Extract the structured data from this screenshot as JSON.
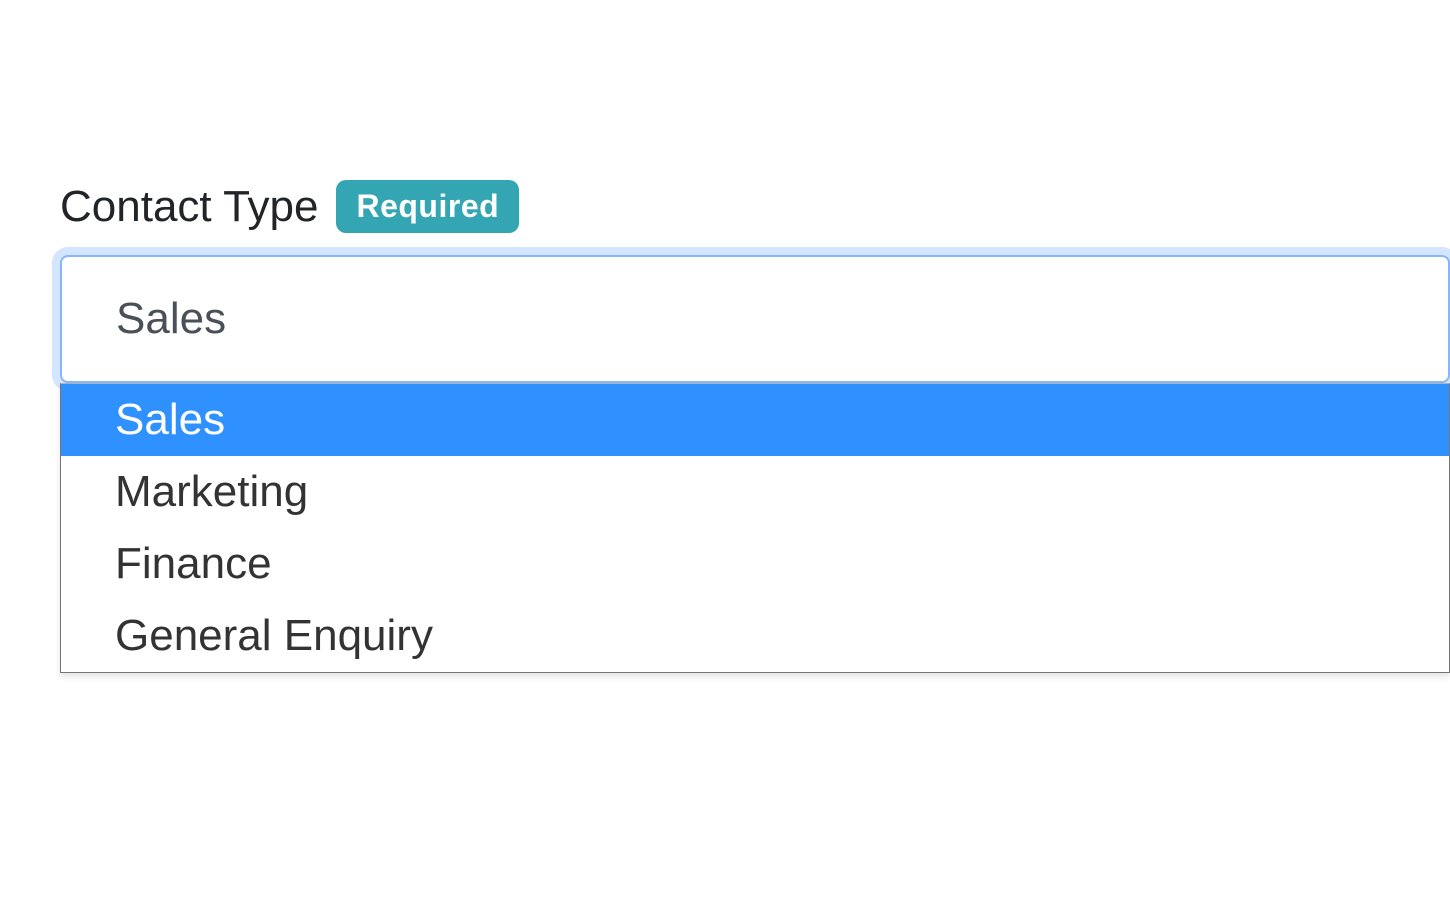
{
  "form": {
    "contactType": {
      "label": "Contact Type",
      "badge": "Required",
      "selectedValue": "Sales",
      "options": [
        "Sales",
        "Marketing",
        "Finance",
        "General Enquiry"
      ],
      "highlightedIndex": 0
    }
  },
  "colors": {
    "badgeBg": "#33a5b3",
    "focusRing": "#86b7fe",
    "highlight": "#2f90ff"
  }
}
